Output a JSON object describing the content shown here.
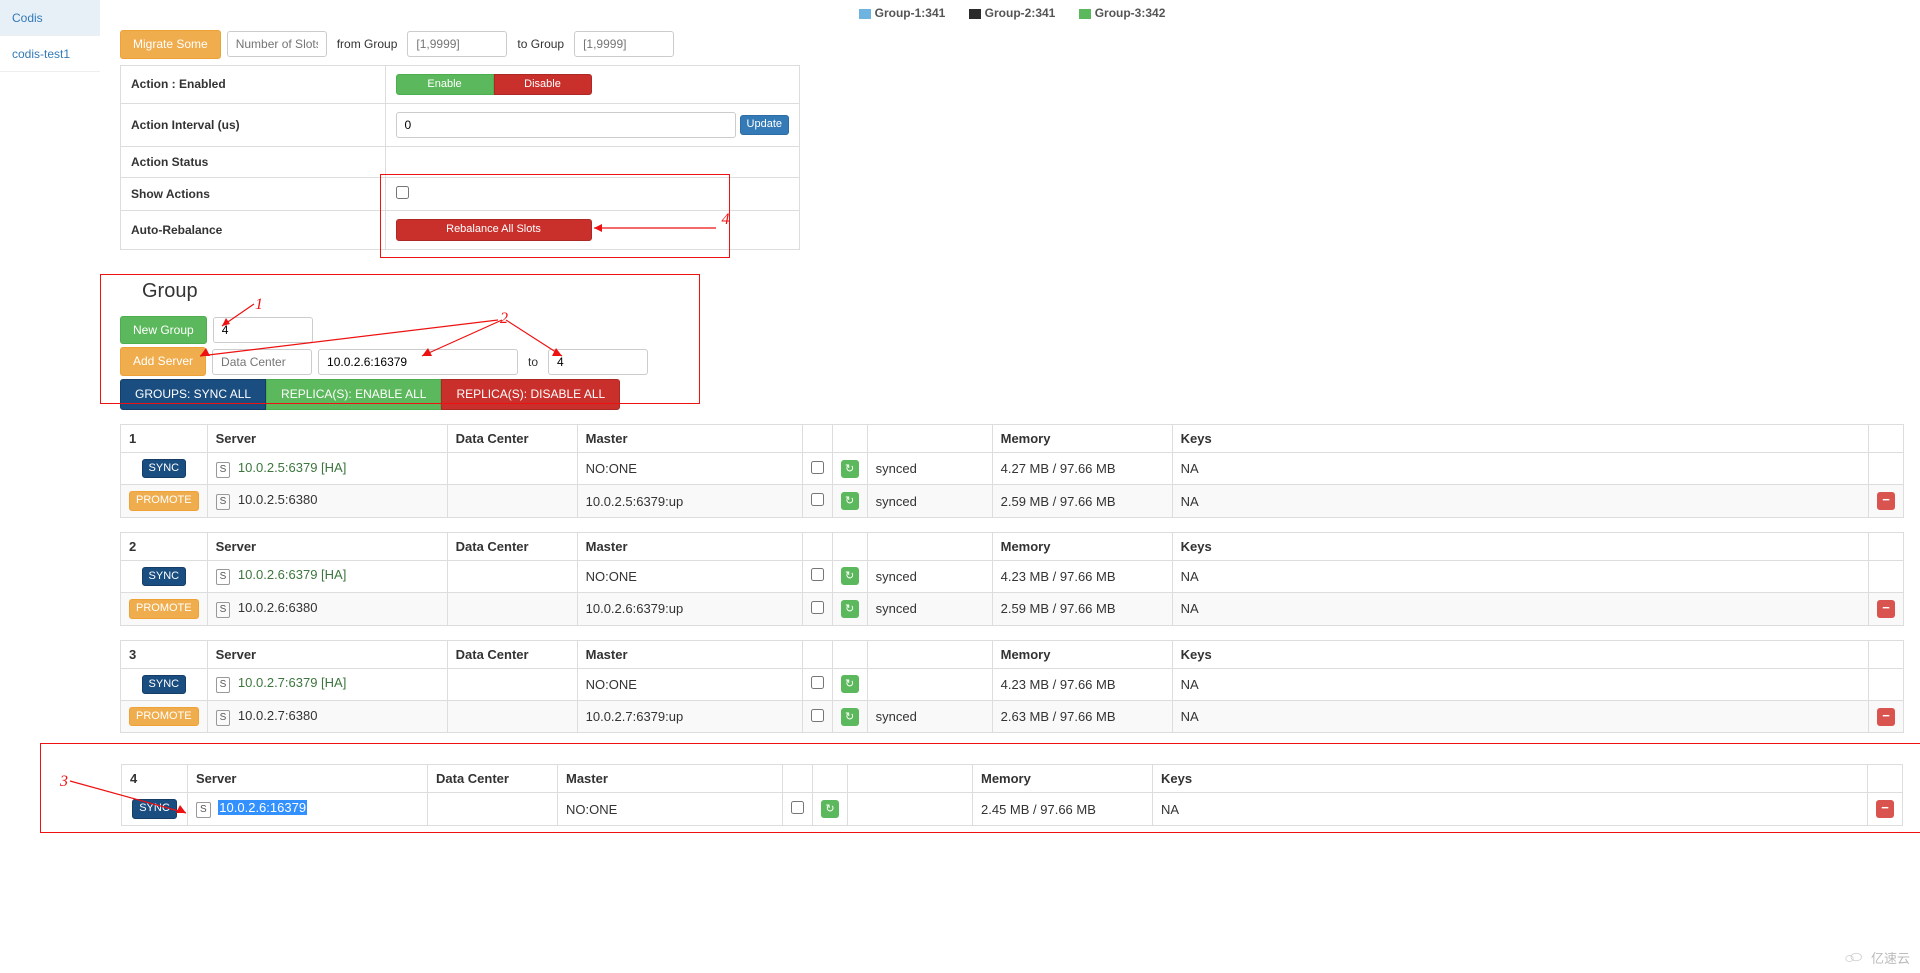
{
  "sidebar": {
    "items": [
      {
        "label": "Codis",
        "active": true
      },
      {
        "label": "codis-test1",
        "active": false
      }
    ]
  },
  "legend": [
    {
      "label": "Group-1:341",
      "color": "#6fb3e0"
    },
    {
      "label": "Group-2:341",
      "color": "#2b2b2b"
    },
    {
      "label": "Group-3:342",
      "color": "#5cb85c"
    }
  ],
  "migrate": {
    "button": "Migrate Some",
    "slots_placeholder": "Number of Slots",
    "from_label": "from Group",
    "to_label": "to Group",
    "from_placeholder": "[1,9999]",
    "to_placeholder": "[1,9999]"
  },
  "actions": {
    "enabled_label": "Action : Enabled",
    "enable_btn": "Enable",
    "disable_btn": "Disable",
    "interval_label": "Action Interval (us)",
    "interval_value": "0",
    "update_btn": "Update",
    "status_label": "Action Status",
    "show_label": "Show Actions",
    "show_checked": false,
    "auto_label": "Auto-Rebalance",
    "rebalance_btn": "Rebalance All Slots"
  },
  "group_form": {
    "title": "Group",
    "new_group_btn": "New Group",
    "new_group_value": "4",
    "add_server_btn": "Add Server",
    "dc_placeholder": "Data Center",
    "addr_value": "10.0.2.6:16379",
    "to_label": "to",
    "to_value": "4",
    "sync_all_btn": "GROUPS: SYNC ALL",
    "enable_all_btn": "REPLICA(S): ENABLE ALL",
    "disable_all_btn": "REPLICA(S): DISABLE ALL"
  },
  "headers": {
    "server": "Server",
    "dc": "Data Center",
    "master": "Master",
    "memory": "Memory",
    "keys": "Keys"
  },
  "btns": {
    "sync": "SYNC",
    "promote": "PROMOTE",
    "badge_s": "S"
  },
  "groups": [
    {
      "id": "1",
      "rows": [
        {
          "action": "sync",
          "addr": "10.0.2.5:6379",
          "ha": "[HA]",
          "link_green": true,
          "dc": "",
          "master": "NO:ONE",
          "chk": false,
          "sync": "synced",
          "mem": "4.27 MB / 97.66 MB",
          "keys": "NA",
          "del": false
        },
        {
          "action": "promote",
          "addr": "10.0.2.5:6380",
          "ha": "",
          "link_green": false,
          "dc": "",
          "master": "10.0.2.5:6379:up",
          "chk": false,
          "sync": "synced",
          "mem": "2.59 MB / 97.66 MB",
          "keys": "NA",
          "del": true
        }
      ]
    },
    {
      "id": "2",
      "rows": [
        {
          "action": "sync",
          "addr": "10.0.2.6:6379",
          "ha": "[HA]",
          "link_green": true,
          "dc": "",
          "master": "NO:ONE",
          "chk": false,
          "sync": "synced",
          "mem": "4.23 MB / 97.66 MB",
          "keys": "NA",
          "del": false
        },
        {
          "action": "promote",
          "addr": "10.0.2.6:6380",
          "ha": "",
          "link_green": false,
          "dc": "",
          "master": "10.0.2.6:6379:up",
          "chk": false,
          "sync": "synced",
          "mem": "2.59 MB / 97.66 MB",
          "keys": "NA",
          "del": true
        }
      ]
    },
    {
      "id": "3",
      "rows": [
        {
          "action": "sync",
          "addr": "10.0.2.7:6379",
          "ha": "[HA]",
          "link_green": true,
          "dc": "",
          "master": "NO:ONE",
          "chk": false,
          "sync": "",
          "mem": "4.23 MB / 97.66 MB",
          "keys": "NA",
          "del": false
        },
        {
          "action": "promote",
          "addr": "10.0.2.7:6380",
          "ha": "",
          "link_green": false,
          "dc": "",
          "master": "10.0.2.7:6379:up",
          "chk": false,
          "sync": "synced",
          "mem": "2.63 MB / 97.66 MB",
          "keys": "NA",
          "del": true
        }
      ]
    },
    {
      "id": "4",
      "rows": [
        {
          "action": "sync",
          "addr": "10.0.2.6:16379",
          "ha": "",
          "link_green": false,
          "highlight": true,
          "dc": "",
          "master": "NO:ONE",
          "chk": false,
          "sync": "",
          "mem": "2.45 MB / 97.66 MB",
          "keys": "NA",
          "del": true
        }
      ]
    }
  ],
  "annotations": {
    "n1": "1",
    "n2": "2",
    "n3": "3",
    "n4": "4"
  },
  "watermark": "亿速云"
}
